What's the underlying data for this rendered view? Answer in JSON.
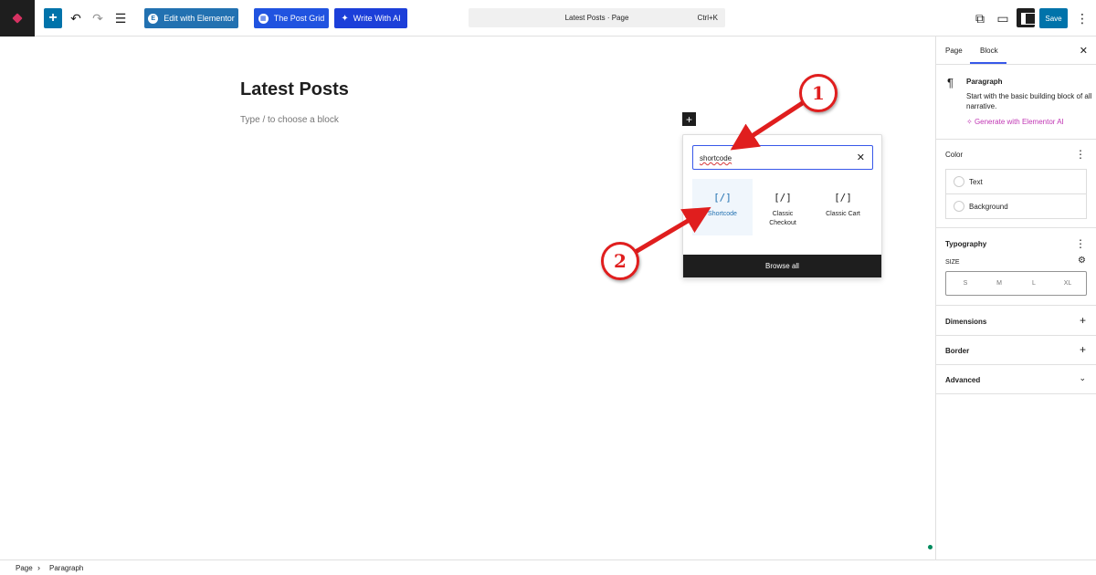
{
  "toolbar": {
    "edit_elementor_label": "Edit with Elementor",
    "post_grid_label": "The Post Grid",
    "write_ai_label": "Write With AI",
    "command_title": "Latest Posts · Page",
    "command_shortcut": "Ctrl+K",
    "save_label": "Save",
    "icons": [
      "wordpress-logo-icon",
      "plus-icon",
      "undo-icon",
      "redo-icon",
      "list-view-icon",
      "external-link-icon",
      "desktop-preview-icon",
      "sidebar-toggle-icon",
      "more-vertical-icon"
    ]
  },
  "editor": {
    "post_title": "Latest Posts",
    "placeholder": "Type / to choose a block"
  },
  "inserter": {
    "search_value": "shortcode",
    "results": [
      {
        "icon": "[/]",
        "label": "Shortcode",
        "active": true
      },
      {
        "icon": "[/]",
        "label": "Classic Checkout"
      },
      {
        "icon": "[/]",
        "label": "Classic Cart"
      }
    ],
    "browse_all_label": "Browse all"
  },
  "sidebar": {
    "tabs": {
      "page": "Page",
      "block": "Block"
    },
    "block": {
      "name": "Paragraph",
      "description": "Start with the basic building block of all narrative.",
      "generate_ai": "Generate with Elementor AI"
    },
    "color": {
      "title": "Color",
      "text": "Text",
      "background": "Background"
    },
    "typography": {
      "title": "Typography",
      "size_label": "SIZE",
      "sizes": [
        "S",
        "M",
        "L",
        "XL"
      ]
    },
    "dimensions_title": "Dimensions",
    "border_title": "Border",
    "advanced_title": "Advanced"
  },
  "footer": {
    "breadcrumb": [
      "Page",
      "Paragraph"
    ]
  },
  "annotations": {
    "one": "1",
    "two": "2"
  },
  "colors": {
    "accent": "#3858e9",
    "wp_blue": "#0073aa",
    "annotation_red": "#e01e1e"
  }
}
